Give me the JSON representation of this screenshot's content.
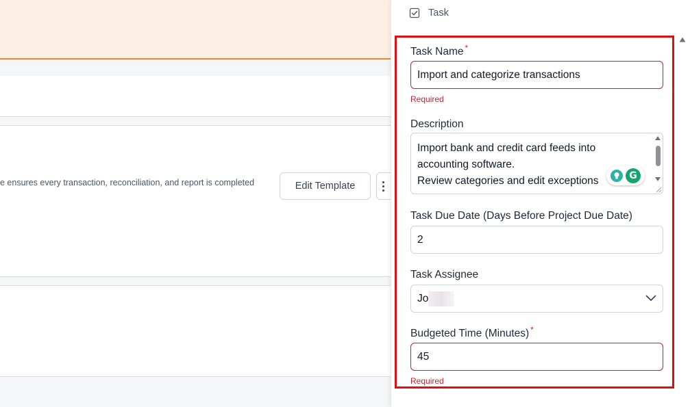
{
  "background": {
    "template_description": "e ensures every transaction, reconciliation, and report is completed",
    "edit_template_label": "Edit Template"
  },
  "drawer": {
    "title": "Task",
    "fields": {
      "task_name": {
        "label": "Task Name",
        "required_mark": "*",
        "value": "Import and categorize transactions",
        "error": "Required"
      },
      "description": {
        "label": "Description",
        "line1": "Import bank and credit card feeds into",
        "line2": "accounting software.",
        "line3": "Review categories and edit exceptions"
      },
      "task_due_date": {
        "label": "Task Due Date (Days Before Project Due Date)",
        "value": "2"
      },
      "task_assignee": {
        "label": "Task Assignee",
        "value": "Jo"
      },
      "budgeted_time": {
        "label": "Budgeted Time (Minutes)",
        "required_mark": "*",
        "value": "45",
        "error": "Required"
      }
    }
  },
  "colors": {
    "error": "#c81e2a",
    "highlight_frame": "#e01010",
    "banner": "#fdefe3",
    "banner_border": "#e08a3c"
  },
  "icons": {
    "header": "checkbox-icon",
    "select": "chevron-down-icon",
    "assistant": "grammarly-icon"
  }
}
